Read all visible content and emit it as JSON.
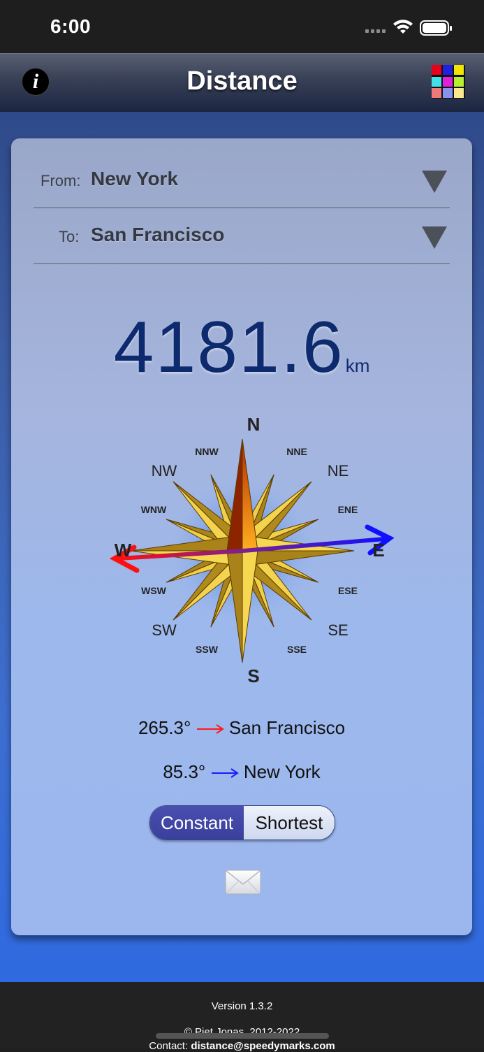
{
  "status_bar": {
    "time": "6:00"
  },
  "nav": {
    "title": "Distance",
    "info_glyph": "i"
  },
  "apps_icon_colors": [
    "#e8001c",
    "#2020e0",
    "#f2e600",
    "#40e0e8",
    "#e020d8",
    "#b8f030",
    "#f07878",
    "#8890f0",
    "#f8e890"
  ],
  "route": {
    "from_label": "From:",
    "from_value": "New York",
    "to_label": "To:",
    "to_value": "San Francisco"
  },
  "distance": {
    "value": "4181.6",
    "unit": "km"
  },
  "compass": {
    "cardinals": {
      "n": "N",
      "e": "E",
      "s": "S",
      "w": "W"
    },
    "intercardinals": {
      "ne": "NE",
      "se": "SE",
      "sw": "SW",
      "nw": "NW"
    },
    "minor": {
      "nne": "NNE",
      "ene": "ENE",
      "ese": "ESE",
      "sse": "SSE",
      "ssw": "SSW",
      "wsw": "WSW",
      "wnw": "WNW",
      "nnw": "NNW"
    },
    "arrow_colors": {
      "to_destination": "#ff1a1a",
      "to_origin": "#1a1aff"
    }
  },
  "bearings": [
    {
      "degrees": "265.3°",
      "place": "San Francisco",
      "color": "#ff1a1a"
    },
    {
      "degrees": "85.3°",
      "place": "New York",
      "color": "#1a1aff"
    }
  ],
  "mode": {
    "constant_label": "Constant",
    "shortest_label": "Shortest",
    "selected": "Constant"
  },
  "footer": {
    "version": "Version 1.3.2",
    "copyright": "© Piet Jonas, 2012-2022",
    "contact_label": "Contact:",
    "contact_email": "distance@speedymarks.com"
  }
}
